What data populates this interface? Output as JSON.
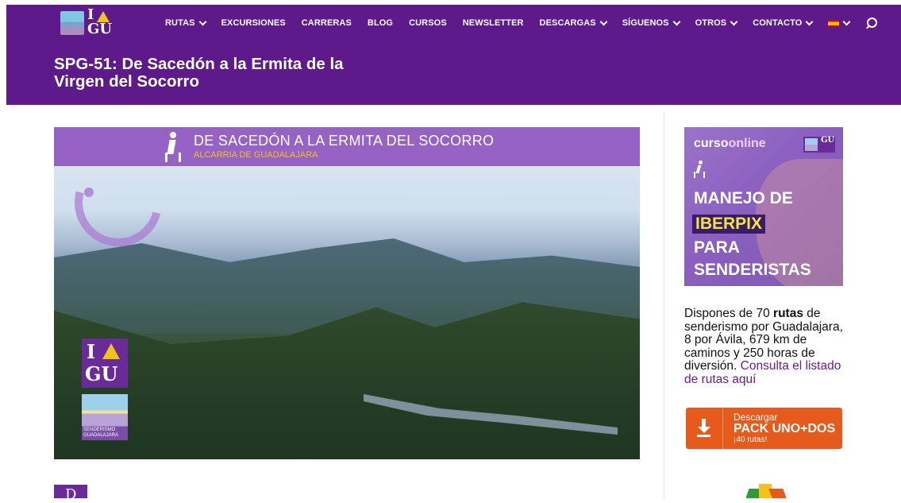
{
  "header": {
    "logo_letters": {
      "top": "I",
      "bottom": "GU"
    },
    "nav": [
      {
        "label": "RUTAS",
        "dropdown": true
      },
      {
        "label": "EXCURSIONES",
        "dropdown": false
      },
      {
        "label": "CARRERAS",
        "dropdown": false
      },
      {
        "label": "BLOG",
        "dropdown": false
      },
      {
        "label": "CURSOS",
        "dropdown": false
      },
      {
        "label": "NEWSLETTER",
        "dropdown": false
      },
      {
        "label": "DESCARGAS",
        "dropdown": true
      },
      {
        "label": "SÍGUENOS",
        "dropdown": true
      },
      {
        "label": "OTROS",
        "dropdown": true
      },
      {
        "label": "CONTACTO",
        "dropdown": true
      }
    ],
    "language_icon": "spain-flag-icon",
    "search_icon": "search-icon",
    "page_title": "SPG-51: De Sacedón a la Ermita de la Virgen del Socorro"
  },
  "hero": {
    "banner_title": "DE SACEDÓN A LA ERMITA DEL SOCORRO",
    "banner_subtitle": "ALCARRIA DE GUADALAJARA",
    "logo_letters": {
      "top": "I",
      "bottom": "GU"
    },
    "badge_text": "SENDERISMO GUADALAJARA"
  },
  "sidebar": {
    "ad": {
      "curso": "curso",
      "online": "online",
      "line1": "MANEJO DE",
      "line2": "IBERPIX",
      "line3": "PARA",
      "line4": "SENDERISTAS",
      "mini_logo": "GU"
    },
    "text_before": "Dispones de 70 ",
    "text_bold": "rutas",
    "text_after": " de senderismo por Guadalajara, 8 por Ávila, 679 km de caminos y 250 horas de diversión. ",
    "text_link": "Consulta el listado de rutas aquí",
    "download": {
      "line1": "Descargar",
      "line2": "PACK UNO+DOS",
      "line3": "¡40 rutas!"
    }
  },
  "bottom": {
    "badge_letter": "D"
  },
  "colors": {
    "brand_purple": "#5e1a8a",
    "accent_yellow": "#f3c21b",
    "button_orange": "#e65a1c",
    "link_purple": "#6a1b9a"
  }
}
